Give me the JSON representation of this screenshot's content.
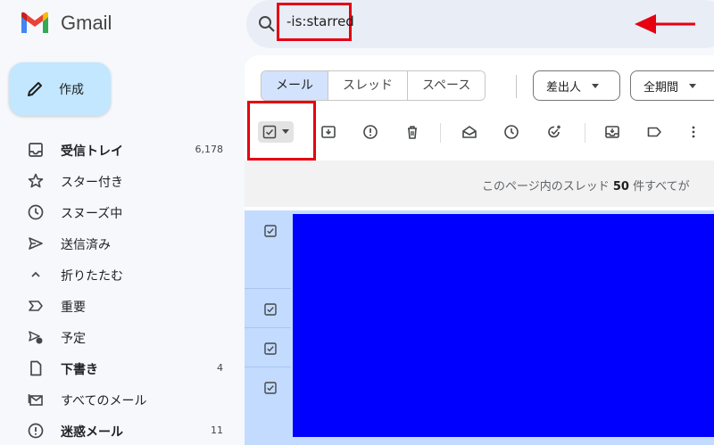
{
  "app": {
    "name": "Gmail"
  },
  "search": {
    "query": "-is:starred"
  },
  "compose": {
    "label": "作成"
  },
  "sidebar": {
    "items": [
      {
        "label": "受信トレイ",
        "count": "6,178",
        "icon": "inbox-icon",
        "bold": true
      },
      {
        "label": "スター付き",
        "count": "",
        "icon": "star-icon",
        "bold": false
      },
      {
        "label": "スヌーズ中",
        "count": "",
        "icon": "clock-icon",
        "bold": false
      },
      {
        "label": "送信済み",
        "count": "",
        "icon": "send-icon",
        "bold": false
      },
      {
        "label": "折りたたむ",
        "count": "",
        "icon": "chevron-up-icon",
        "bold": false
      },
      {
        "label": "重要",
        "count": "",
        "icon": "important-icon",
        "bold": false
      },
      {
        "label": "予定",
        "count": "",
        "icon": "scheduled-send-icon",
        "bold": false
      },
      {
        "label": "下書き",
        "count": "4",
        "icon": "draft-icon",
        "bold": true
      },
      {
        "label": "すべてのメール",
        "count": "",
        "icon": "all-mail-icon",
        "bold": false
      },
      {
        "label": "迷惑メール",
        "count": "11",
        "icon": "spam-icon",
        "bold": true
      }
    ]
  },
  "filters": {
    "tabs": [
      {
        "label": "メール",
        "active": true
      },
      {
        "label": "スレッド",
        "active": false
      },
      {
        "label": "スペース",
        "active": false
      }
    ],
    "from_label": "差出人",
    "date_label": "全期間"
  },
  "toolbar": {
    "icons": [
      "select-all-checkbox-icon",
      "archive-icon",
      "report-spam-icon",
      "delete-icon",
      "mark-as-read-icon",
      "snooze-icon",
      "add-to-tasks-icon",
      "move-to-icon",
      "label-icon",
      "more-icon"
    ]
  },
  "info": {
    "prefix": "このページ内のスレッド ",
    "count": "50",
    "suffix": " 件すべてが"
  },
  "colors": {
    "annotation": "#e60012",
    "selected_row": "#c2dbff",
    "redaction": "#0000ff",
    "active_tab": "#d3e3fd",
    "compose": "#c2e7ff"
  }
}
